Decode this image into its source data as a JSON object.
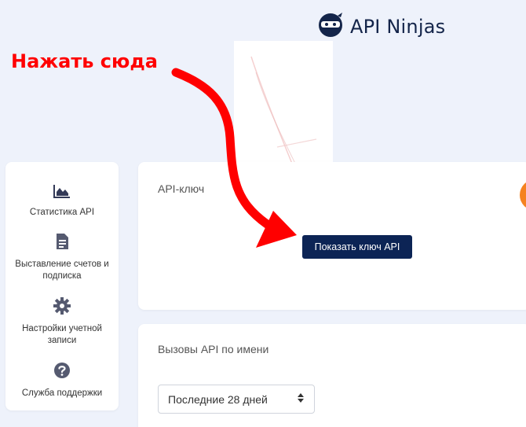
{
  "header": {
    "logo_text": "API Ninjas",
    "logo_icon": "ninja-icon"
  },
  "annotation": {
    "text": "Нажать сюда",
    "color": "#ff0000"
  },
  "sidebar": {
    "items": [
      {
        "label": "Статистика API",
        "icon": "chart-icon"
      },
      {
        "label": "Выставление счетов и подписка",
        "icon": "document-icon"
      },
      {
        "label": "Настройки учетной записи",
        "icon": "gear-icon"
      },
      {
        "label": "Служба поддержки",
        "icon": "help-icon"
      }
    ]
  },
  "api_key_card": {
    "title": "API-ключ",
    "button_label": "Показать ключ API"
  },
  "calls_card": {
    "title": "Вызовы API по имени",
    "range_select": {
      "selected": "Последние 28 дней"
    }
  },
  "colors": {
    "background": "#eef2fb",
    "primary_button": "#0c2455",
    "accent_orange": "#f58220"
  }
}
